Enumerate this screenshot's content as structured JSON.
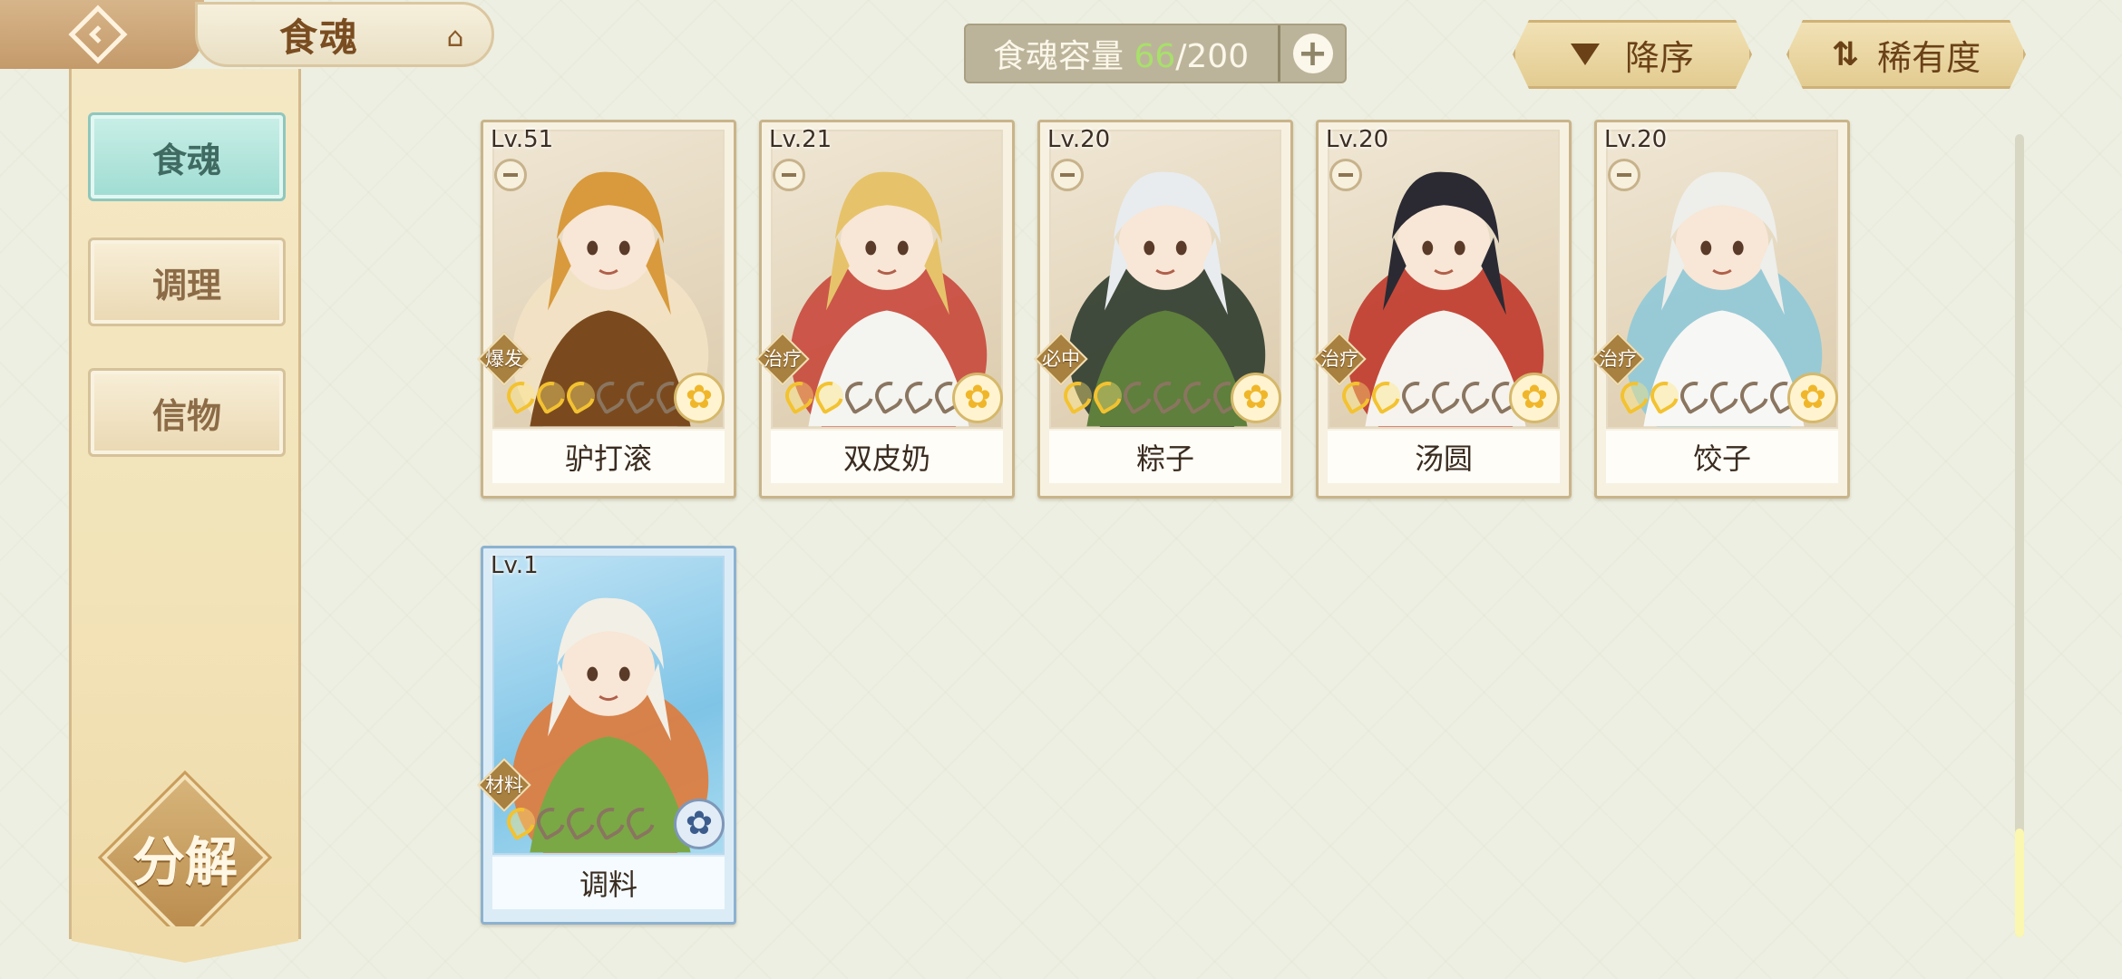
{
  "header": {
    "title": "食魂",
    "capacity": {
      "label": "食魂容量 ",
      "current": "66",
      "separator": "/",
      "max": "200"
    },
    "sort_order_label": "降序",
    "sort_key_label": "稀有度"
  },
  "sidebar": {
    "tabs": [
      {
        "label": "食魂",
        "active": true
      },
      {
        "label": "调理",
        "active": false
      },
      {
        "label": "信物",
        "active": false
      }
    ],
    "decompose_label": "分解"
  },
  "cards": [
    {
      "level": "Lv.51",
      "role": "爆发",
      "name": "驴打滚",
      "grade": 3,
      "grade_max": 6,
      "palette": [
        "#d89a3c",
        "#7a4a1e",
        "#f3e2c4"
      ]
    },
    {
      "level": "Lv.21",
      "role": "治疗",
      "name": "双皮奶",
      "grade": 2,
      "grade_max": 6,
      "palette": [
        "#e6c36a",
        "#f4f4f0",
        "#c8483c"
      ]
    },
    {
      "level": "Lv.20",
      "role": "必中",
      "name": "粽子",
      "grade": 2,
      "grade_max": 6,
      "palette": [
        "#e8ecef",
        "#5f7f3c",
        "#2d3b2e"
      ]
    },
    {
      "level": "Lv.20",
      "role": "治疗",
      "name": "汤圆",
      "grade": 2,
      "grade_max": 6,
      "palette": [
        "#2b2a33",
        "#f6f3ee",
        "#c0392b"
      ]
    },
    {
      "level": "Lv.20",
      "role": "治疗",
      "name": "饺子",
      "grade": 2,
      "grade_max": 6,
      "palette": [
        "#eeeeea",
        "#f7f7f5",
        "#8fc9d8"
      ]
    },
    {
      "level": "Lv.1",
      "role": "材料",
      "name": "调料",
      "grade": 1,
      "grade_max": 5,
      "palette": [
        "#f2efe6",
        "#7aa845",
        "#e07a3a"
      ],
      "blue": true
    }
  ]
}
